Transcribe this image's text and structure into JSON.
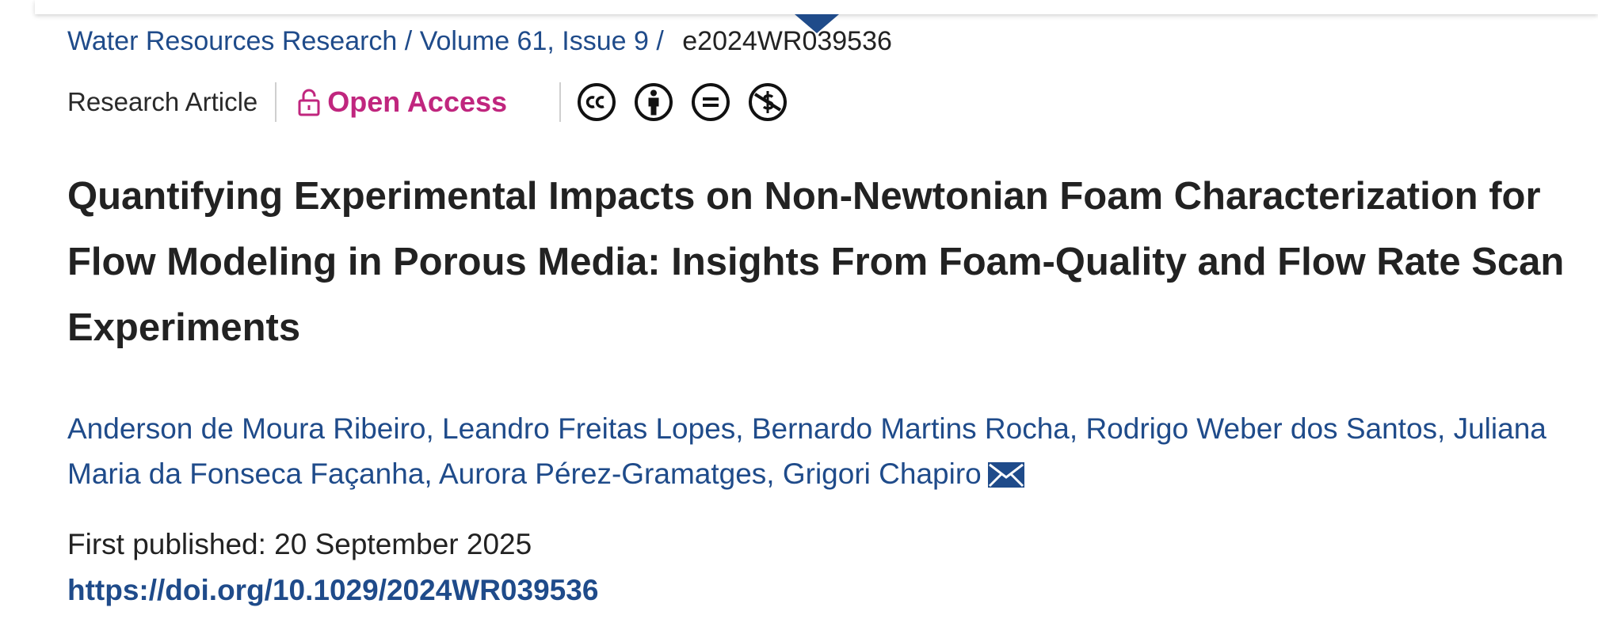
{
  "breadcrumb": {
    "journal": "Water Resources Research",
    "separator": "/",
    "volume_issue": "Volume 61, Issue 9",
    "separator2": "/",
    "article_id": "e2024WR039536"
  },
  "meta": {
    "article_type": "Research Article",
    "access_label": "Open Access",
    "license_icons": [
      "cc-icon",
      "attribution-icon",
      "no-derivatives-icon",
      "non-commercial-icon"
    ]
  },
  "title": "Quantifying Experimental Impacts on Non-Newtonian Foam Characterization for Flow Modeling in Porous Media: Insights From Foam-Quality and Flow Rate Scan Experiments",
  "authors": [
    "Anderson de Moura Ribeiro",
    "Leandro Freitas Lopes",
    "Bernardo Martins Rocha",
    "Rodrigo Weber dos Santos",
    "Juliana Maria da Fonseca Façanha",
    "Aurora Pérez-Gramatges",
    "Grigori Chapiro"
  ],
  "author_separator": ",",
  "publication": {
    "first_published": "First published: 20 September 2025",
    "doi": "https://doi.org/10.1029/2024WR039536"
  },
  "colors": {
    "link": "#1f4b8a",
    "open_access": "#c0267e",
    "text": "#222222"
  }
}
